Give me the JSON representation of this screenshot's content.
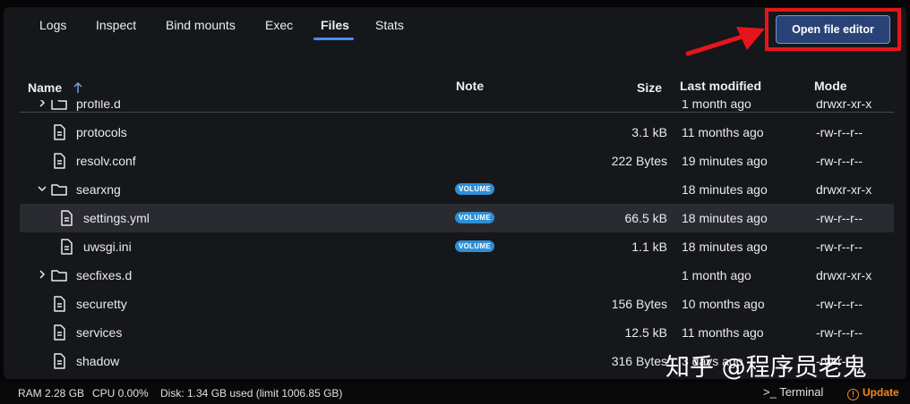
{
  "tabs": [
    {
      "label": "Logs"
    },
    {
      "label": "Inspect"
    },
    {
      "label": "Bind mounts"
    },
    {
      "label": "Exec"
    },
    {
      "label": "Files"
    },
    {
      "label": "Stats"
    }
  ],
  "active_tab": "Files",
  "open_editor_label": "Open file editor",
  "table": {
    "headers": {
      "name": "Name",
      "note": "Note",
      "size": "Size",
      "modified": "Last modified",
      "mode": "Mode"
    },
    "sort": "Name ascending",
    "rows": [
      {
        "name": "profile.d",
        "type": "folder",
        "expanded": false,
        "note": "",
        "size": "",
        "modified": "1 month ago",
        "mode": "drwxr-xr-x"
      },
      {
        "name": "protocols",
        "type": "file",
        "note": "",
        "size": "3.1 kB",
        "modified": "11 months ago",
        "mode": "-rw-r--r--"
      },
      {
        "name": "resolv.conf",
        "type": "file",
        "note": "",
        "size": "222 Bytes",
        "modified": "19 minutes ago",
        "mode": "-rw-r--r--"
      },
      {
        "name": "searxng",
        "type": "folder",
        "expanded": true,
        "note": "VOLUME",
        "size": "",
        "modified": "18 minutes ago",
        "mode": "drwxr-xr-x"
      },
      {
        "name": "settings.yml",
        "type": "file",
        "child": true,
        "selected": true,
        "note": "VOLUME",
        "size": "66.5 kB",
        "modified": "18 minutes ago",
        "mode": "-rw-r--r--"
      },
      {
        "name": "uwsgi.ini",
        "type": "file",
        "child": true,
        "note": "VOLUME",
        "size": "1.1 kB",
        "modified": "18 minutes ago",
        "mode": "-rw-r--r--"
      },
      {
        "name": "secfixes.d",
        "type": "folder",
        "expanded": false,
        "note": "",
        "size": "",
        "modified": "1 month ago",
        "mode": "drwxr-xr-x"
      },
      {
        "name": "securetty",
        "type": "file",
        "note": "",
        "size": "156 Bytes",
        "modified": "10 months ago",
        "mode": "-rw-r--r--"
      },
      {
        "name": "services",
        "type": "file",
        "note": "",
        "size": "12.5 kB",
        "modified": "11 months ago",
        "mode": "-rw-r--r--"
      },
      {
        "name": "shadow",
        "type": "file",
        "note": "",
        "size": "316 Bytes",
        "modified": "3 days ago",
        "mode": "-rw-r-----"
      }
    ]
  },
  "status": {
    "ram": "RAM 2.28 GB",
    "cpu": "CPU 0.00%",
    "disk": "Disk: 1.34 GB used (limit 1006.85 GB)",
    "terminal": "Terminal",
    "update": "Update"
  },
  "watermark": "知乎 @程序员老鬼",
  "colors": {
    "accent": "#4b8dee",
    "badge": "#2d8fd6",
    "highlight_box": "#e5151b",
    "update": "#f08a22"
  }
}
